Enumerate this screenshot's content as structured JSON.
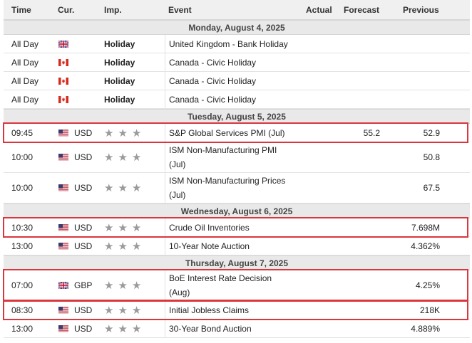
{
  "header": {
    "time": "Time",
    "cur": "Cur.",
    "imp": "Imp.",
    "event": "Event",
    "actual": "Actual",
    "forecast": "Forecast",
    "previous": "Previous"
  },
  "days": [
    {
      "date": "Monday, August 4, 2025",
      "events": [
        {
          "time": "All Day",
          "flag": "uk-flag-icon",
          "currency": "",
          "imp": "Holiday",
          "holiday": true,
          "event": "United Kingdom - Bank Holiday",
          "actual": "",
          "forecast": "",
          "previous": ""
        },
        {
          "time": "All Day",
          "flag": "canada-flag-icon",
          "currency": "",
          "imp": "Holiday",
          "holiday": true,
          "event": "Canada - Civic Holiday",
          "actual": "",
          "forecast": "",
          "previous": ""
        },
        {
          "time": "All Day",
          "flag": "canada-flag-icon",
          "currency": "",
          "imp": "Holiday",
          "holiday": true,
          "event": "Canada - Civic Holiday",
          "actual": "",
          "forecast": "",
          "previous": ""
        },
        {
          "time": "All Day",
          "flag": "canada-flag-icon",
          "currency": "",
          "imp": "Holiday",
          "holiday": true,
          "event": "Canada - Civic Holiday",
          "actual": "",
          "forecast": "",
          "previous": ""
        }
      ]
    },
    {
      "date": "Tuesday, August 5, 2025",
      "events": [
        {
          "time": "09:45",
          "flag": "us-flag-icon",
          "currency": "USD",
          "stars": 3,
          "event": "S&P Global Services PMI (Jul)",
          "actual": "",
          "forecast": "55.2",
          "previous": "52.9",
          "highlighted": true
        },
        {
          "time": "10:00",
          "flag": "us-flag-icon",
          "currency": "USD",
          "stars": 3,
          "event": "ISM Non-Manufacturing PMI (Jul)",
          "actual": "",
          "forecast": "",
          "previous": "50.8",
          "tall": true
        },
        {
          "time": "10:00",
          "flag": "us-flag-icon",
          "currency": "USD",
          "stars": 3,
          "event": "ISM Non-Manufacturing Prices (Jul)",
          "actual": "",
          "forecast": "",
          "previous": "67.5",
          "tall": true
        }
      ]
    },
    {
      "date": "Wednesday, August 6, 2025",
      "events": [
        {
          "time": "10:30",
          "flag": "us-flag-icon",
          "currency": "USD",
          "stars": 3,
          "event": "Crude Oil Inventories",
          "actual": "",
          "forecast": "",
          "previous": "7.698M",
          "highlighted": true
        },
        {
          "time": "13:00",
          "flag": "us-flag-icon",
          "currency": "USD",
          "stars": 3,
          "event": "10-Year Note Auction",
          "actual": "",
          "forecast": "",
          "previous": "4.362%"
        }
      ]
    },
    {
      "date": "Thursday, August 7, 2025",
      "events": [
        {
          "time": "07:00",
          "flag": "uk-flag-icon",
          "currency": "GBP",
          "stars": 3,
          "event": "BoE Interest Rate Decision (Aug)",
          "actual": "",
          "forecast": "",
          "previous": "4.25%",
          "tall": true,
          "highlighted": true
        },
        {
          "time": "08:30",
          "flag": "us-flag-icon",
          "currency": "USD",
          "stars": 3,
          "event": "Initial Jobless Claims",
          "actual": "",
          "forecast": "",
          "previous": "218K",
          "highlighted": true
        },
        {
          "time": "13:00",
          "flag": "us-flag-icon",
          "currency": "USD",
          "stars": 3,
          "event": "30-Year Bond Auction",
          "actual": "",
          "forecast": "",
          "previous": "4.889%"
        }
      ]
    }
  ],
  "colors": {
    "highlight": "#d9363e",
    "star": "#9a9a9a"
  }
}
